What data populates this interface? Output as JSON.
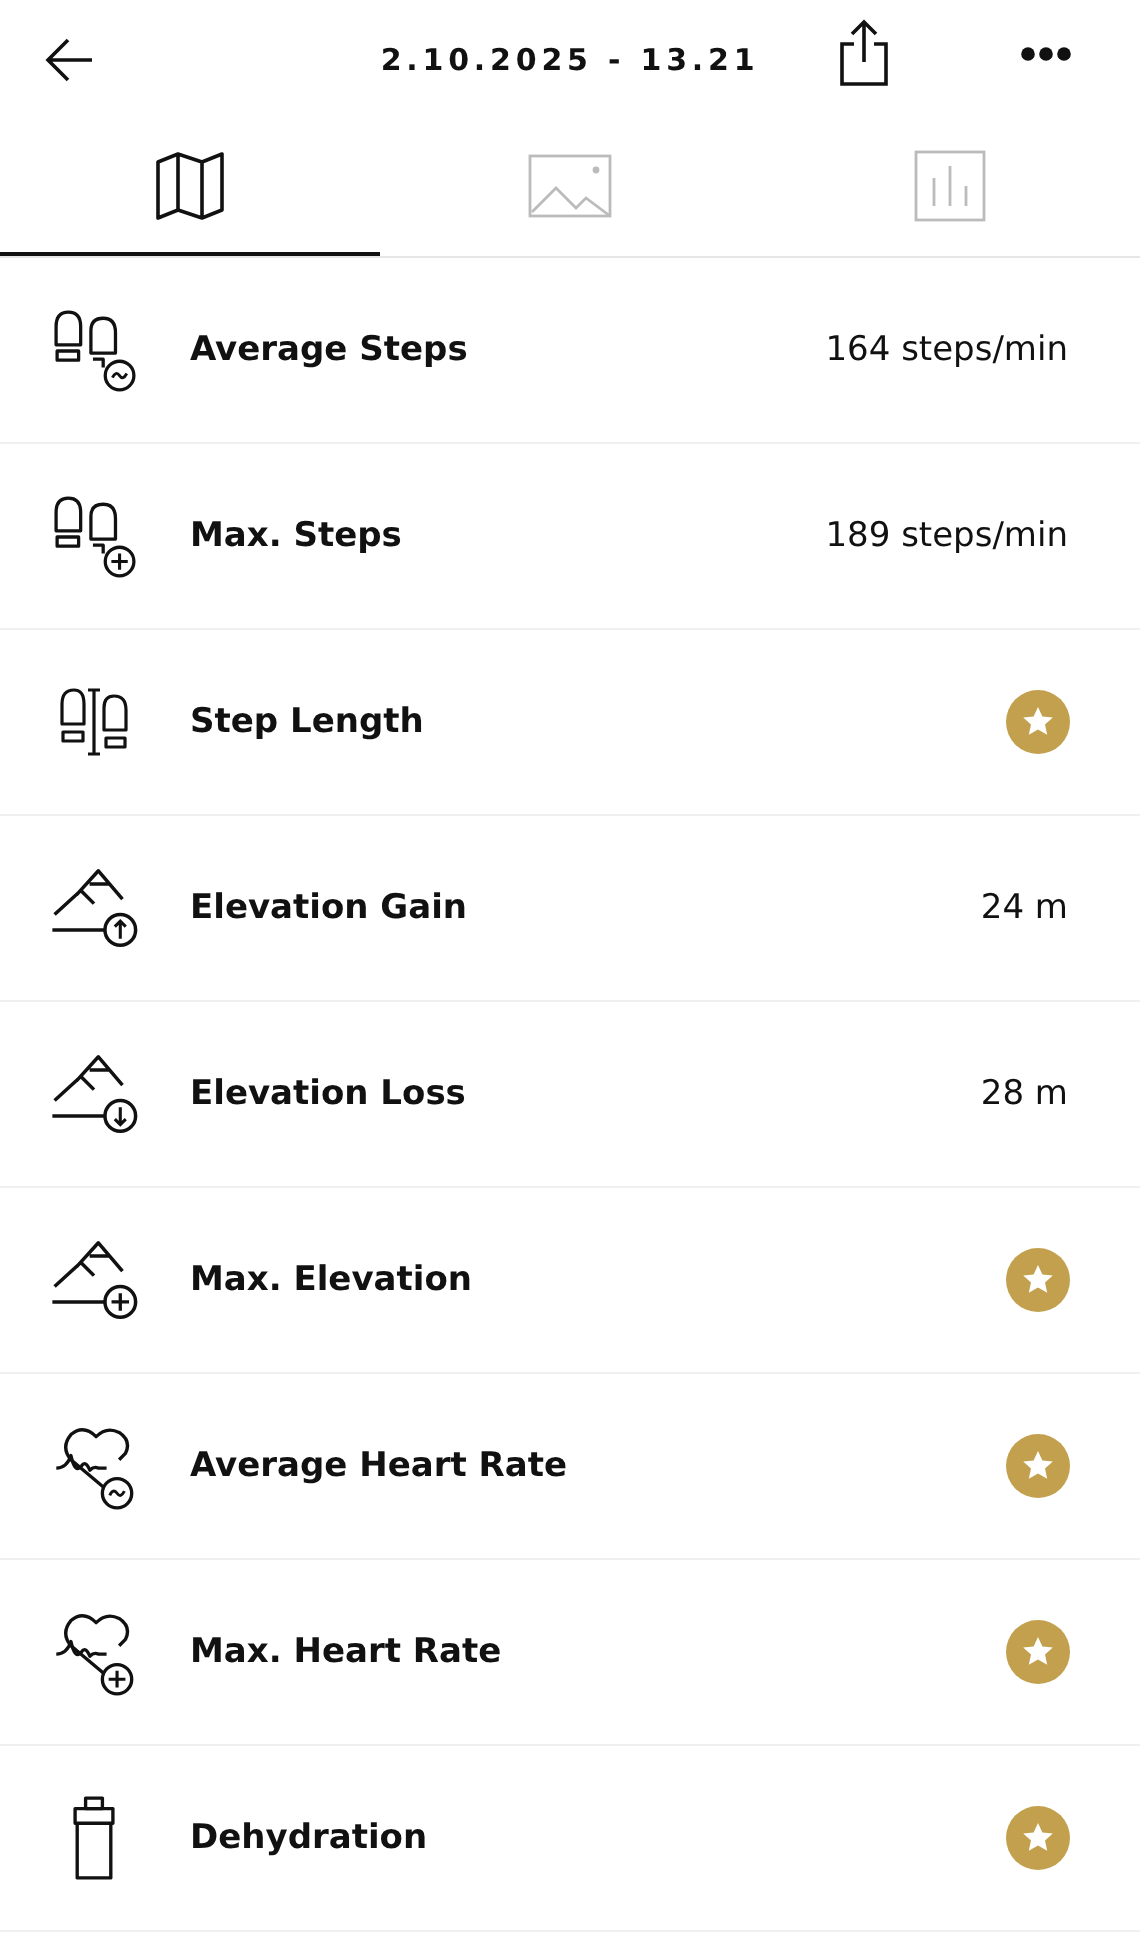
{
  "header": {
    "title": "2.10.2025 - 13.21"
  },
  "tabs": [
    {
      "kind": "map",
      "selected": true
    },
    {
      "kind": "photo",
      "selected": false
    },
    {
      "kind": "chart",
      "selected": false
    }
  ],
  "metrics": [
    {
      "label": "Average Steps",
      "kind": "value",
      "value": "164 steps/min"
    },
    {
      "label": "Max. Steps",
      "kind": "value",
      "value": "189 steps/min"
    },
    {
      "label": "Step Length",
      "kind": "premium"
    },
    {
      "label": "Elevation Gain",
      "kind": "value",
      "value": "24 m"
    },
    {
      "label": "Elevation Loss",
      "kind": "value",
      "value": "28 m"
    },
    {
      "label": "Max. Elevation",
      "kind": "premium"
    },
    {
      "label": "Average Heart Rate",
      "kind": "premium"
    },
    {
      "label": "Max. Heart Rate",
      "kind": "premium"
    },
    {
      "label": "Dehydration",
      "kind": "premium"
    }
  ]
}
